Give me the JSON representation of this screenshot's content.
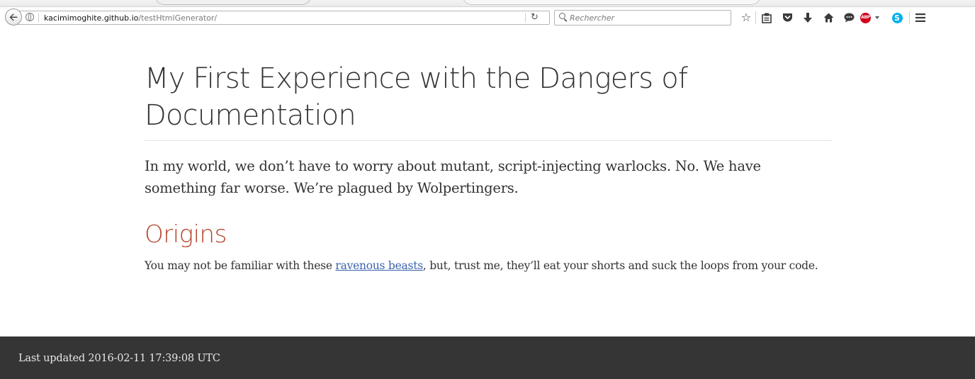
{
  "browser": {
    "url_host": "kacimimoghite.github.io",
    "url_path": "/testHtmlGenerator/",
    "search_placeholder": "Rechercher",
    "icons": [
      "back-arrow-icon",
      "globe-icon",
      "reload-icon",
      "search-icon",
      "bookmark-star-icon",
      "reading-list-icon",
      "pocket-icon",
      "download-arrow-icon",
      "home-icon",
      "chat-icon",
      "adblock-plus-icon",
      "skype-icon",
      "hamburger-menu-icon"
    ],
    "adblock_badge": "ABP",
    "skype_badge": "S"
  },
  "article": {
    "title": "My First Experience with the Dangers of Documentation",
    "lead": "In my world, we don’t have to worry about mutant, script-injecting warlocks. No. We have something far worse. We’re plagued by Wolpertingers.",
    "section_heading": "Origins",
    "para_before_link": "You may not be familiar with these ",
    "link_text": "ravenous beasts",
    "para_after_link": ", but, trust me, they’ll eat your shorts and suck the loops from your code."
  },
  "footer": {
    "text": "Last updated 2016-02-11 17:39:08 UTC"
  },
  "colors": {
    "heading_accent": "#b5452d",
    "link": "#3b62b0",
    "footer_bg": "#353535"
  }
}
